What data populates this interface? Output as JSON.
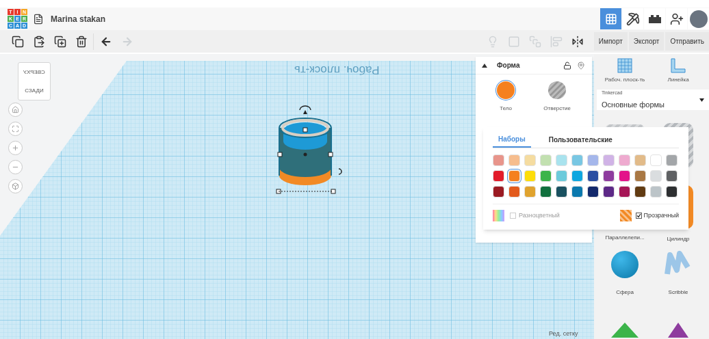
{
  "header": {
    "logo_letters": [
      "T",
      "I",
      "N",
      "K",
      "E",
      "R",
      "C",
      "A",
      "D"
    ],
    "title": "Marina stakan"
  },
  "view_buttons": [
    {
      "kind": "grid",
      "selected": true
    },
    {
      "kind": "pickaxe",
      "selected": false
    },
    {
      "kind": "brick",
      "selected": false
    },
    {
      "kind": "user-add",
      "selected": false
    },
    {
      "kind": "avatar",
      "selected": false
    }
  ],
  "edit_tools": [
    {
      "kind": "copy",
      "disabled": false
    },
    {
      "kind": "paste",
      "disabled": false
    },
    {
      "kind": "duplicate",
      "disabled": false
    },
    {
      "kind": "delete",
      "disabled": false
    },
    {
      "kind": "undo",
      "disabled": false
    },
    {
      "kind": "redo",
      "disabled": true
    }
  ],
  "shape_tools": [
    {
      "kind": "note",
      "disabled": true
    },
    {
      "kind": "group",
      "disabled": true
    },
    {
      "kind": "ungroup",
      "disabled": true
    },
    {
      "kind": "align",
      "disabled": true
    },
    {
      "kind": "mirror",
      "disabled": false
    }
  ],
  "file_buttons": [
    "Импорт",
    "Экспорт",
    "Отправить"
  ],
  "view_cube": {
    "top": "СВЕРХУ",
    "side": "СЗАДИ"
  },
  "workplane_label": "Рабоч. плоск-ть",
  "inspector": {
    "title": "Форма",
    "locked": false,
    "modes": [
      {
        "kind": "solid",
        "label": "Тело",
        "selected": true,
        "color": "#f5801f"
      },
      {
        "kind": "hole",
        "label": "Отверстие",
        "selected": false
      }
    ]
  },
  "color_picker": {
    "tabs": [
      {
        "label": "Наборы",
        "selected": true
      },
      {
        "label": "Пользовательские",
        "selected": false
      }
    ],
    "swatches": [
      [
        {
          "color": "#e8958b",
          "selected": false
        },
        {
          "color": "#f6bd8e",
          "selected": false
        },
        {
          "color": "#f5dca0",
          "selected": false
        },
        {
          "color": "#c2e0b0",
          "selected": false
        },
        {
          "color": "#a9e3ee",
          "selected": false
        },
        {
          "color": "#79c7e3",
          "selected": false
        },
        {
          "color": "#a5b7eb",
          "selected": false
        },
        {
          "color": "#d0b3e6",
          "selected": false
        },
        {
          "color": "#eeaacf",
          "selected": false
        },
        {
          "color": "#e2bb89",
          "selected": false
        },
        {
          "color": "#ffffff",
          "selected": false
        },
        {
          "color": "#a3a6a9",
          "selected": false
        }
      ],
      [
        {
          "color": "#e21b2a",
          "selected": false
        },
        {
          "color": "#f5801f",
          "selected": true
        },
        {
          "color": "#fddd0a",
          "selected": false
        },
        {
          "color": "#3cb44a",
          "selected": false
        },
        {
          "color": "#6ccbdb",
          "selected": false
        },
        {
          "color": "#0ea7e0",
          "selected": false
        },
        {
          "color": "#2a4ea2",
          "selected": false
        },
        {
          "color": "#8e3c9e",
          "selected": false
        },
        {
          "color": "#e3128a",
          "selected": false
        },
        {
          "color": "#a97844",
          "selected": false
        },
        {
          "color": "#dadddf",
          "selected": false
        },
        {
          "color": "#5f6163",
          "selected": false
        }
      ],
      [
        {
          "color": "#9b1b23",
          "selected": false
        },
        {
          "color": "#e25a1c",
          "selected": false
        },
        {
          "color": "#e0a32e",
          "selected": false
        },
        {
          "color": "#11703e",
          "selected": false
        },
        {
          "color": "#1a5160",
          "selected": false
        },
        {
          "color": "#0b79ae",
          "selected": false
        },
        {
          "color": "#13296c",
          "selected": false
        },
        {
          "color": "#5d2987",
          "selected": false
        },
        {
          "color": "#a61657",
          "selected": false
        },
        {
          "color": "#613b12",
          "selected": false
        },
        {
          "color": "#bcc4c8",
          "selected": false
        },
        {
          "color": "#2d2f31",
          "selected": false
        }
      ]
    ],
    "multicolor": {
      "label": "Разноцветный",
      "checked": false,
      "disabled": true
    },
    "transparent": {
      "label": "Прозрачный",
      "checked": true
    }
  },
  "library": {
    "tools": [
      {
        "kind": "workplane",
        "label": "Рабоч. плоск-ть"
      },
      {
        "kind": "ruler",
        "label": "Линейка"
      }
    ],
    "source": "Tinkercad",
    "category": "Основные формы",
    "shapes": [
      {
        "kind": "box-hole"
      },
      {
        "kind": "cylinder-hole"
      },
      {
        "kind": "box",
        "label": "Параллелепи..."
      },
      {
        "kind": "cylinder",
        "label": "Цилиндр"
      },
      {
        "kind": "sphere",
        "label": "Сфера"
      },
      {
        "kind": "scribble",
        "label": "Scribble"
      },
      {
        "kind": "pyramid"
      },
      {
        "kind": "cone"
      }
    ]
  },
  "edit_grid_button": "Ред. сетку"
}
